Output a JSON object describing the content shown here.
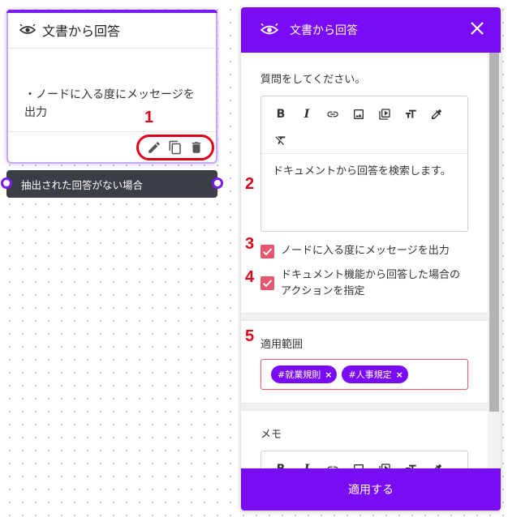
{
  "node": {
    "title": "文書から回答",
    "body_text": "・ノードに入る度にメッセージを出力",
    "branch_label": "抽出された回答がない場合",
    "tools": [
      "pencil-icon",
      "copy-icon",
      "trash-icon"
    ]
  },
  "annotations": [
    "1",
    "2",
    "3",
    "4",
    "5"
  ],
  "panel": {
    "title": "文書から回答",
    "question_label": "質問をしてください。",
    "question_text": "ドキュメントから回答を検索します。",
    "toolbar_bold": "B",
    "toolbar_italic": "I",
    "checkbox_message": "ノードに入る度にメッセージを出力",
    "checkbox_action": "ドキュメント機能から回答した場合のアクションを指定",
    "scope_label": "適用範囲",
    "tags": [
      {
        "label": "#就業規則",
        "remove": "×"
      },
      {
        "label": "#人事規定",
        "remove": "×"
      }
    ],
    "memo_label": "メモ",
    "apply_button": "適用する"
  },
  "colors": {
    "brand_purple": "#7a0cf5",
    "checkbox_pink": "#e8556e",
    "annotation_red": "#e0001a",
    "branch_dark": "#3b3f45"
  }
}
